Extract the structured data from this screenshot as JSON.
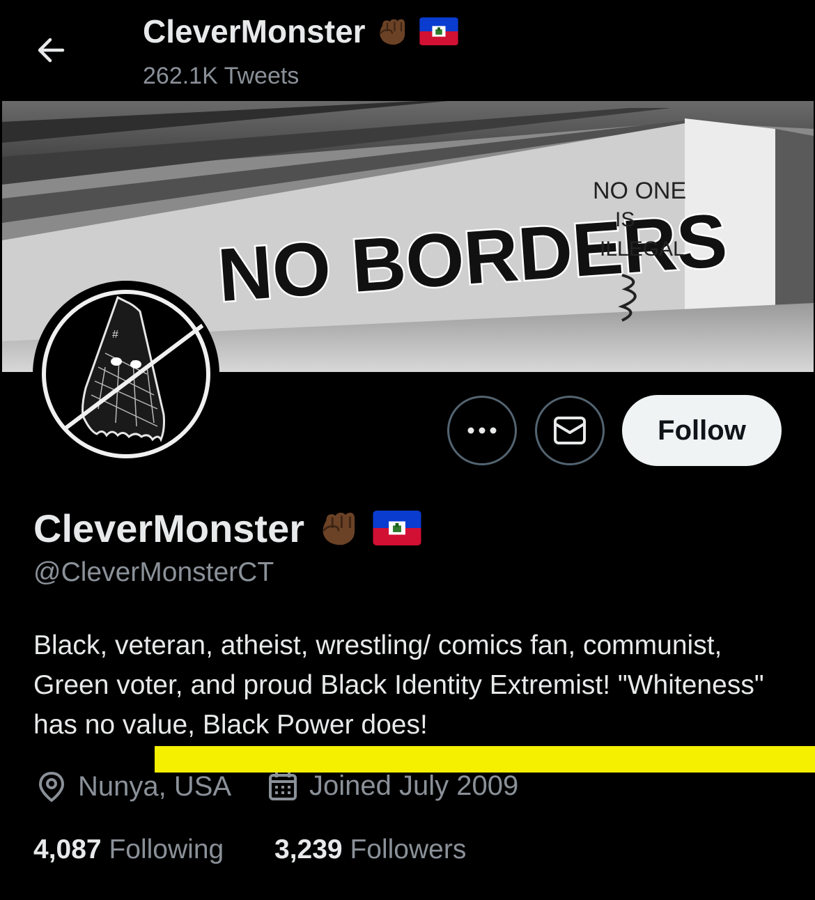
{
  "header": {
    "display_name": "CleverMonster",
    "tweet_count": "262.1K Tweets",
    "back_icon": "arrow-left-icon"
  },
  "banner": {
    "graffiti_main": "NO BORDERS",
    "graffiti_side_1": "NO ONE",
    "graffiti_side_2": "IS",
    "graffiti_side_3": "ILLEGAL"
  },
  "actions": {
    "more_icon": "more-horizontal-icon",
    "message_icon": "envelope-icon",
    "follow_label": "Follow"
  },
  "profile": {
    "display_name": "CleverMonster",
    "handle": "@CleverMonsterCT",
    "bio": "Black, veteran, atheist, wrestling/ comics fan, communist, Green voter, and proud Black Identity Extremist! \"Whiteness\" has no value, Black Power does!",
    "location": "Nunya, USA",
    "joined": "Joined July 2009",
    "following_count": "4,087",
    "following_label": "Following",
    "followers_count": "3,239",
    "followers_label": "Followers"
  },
  "colors": {
    "background": "#000000",
    "text_primary": "#e7e9ea",
    "text_secondary": "#8b9199",
    "follow_button_bg": "#eff3f4",
    "highlight": "#f5ef00"
  }
}
